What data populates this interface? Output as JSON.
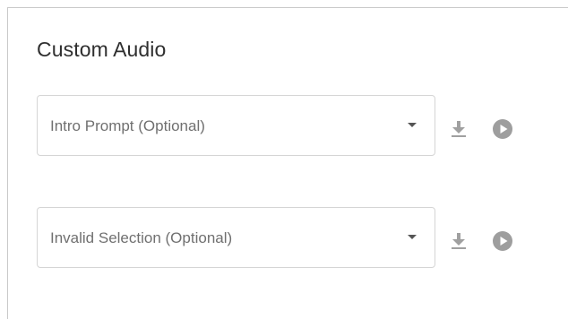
{
  "section": {
    "title": "Custom Audio"
  },
  "rows": [
    {
      "select_label": "Intro Prompt (Optional)"
    },
    {
      "select_label": "Invalid Selection (Optional)"
    }
  ],
  "icons": {
    "download": "download-icon",
    "play": "play-circle-icon",
    "caret": "arrow-drop-down-icon"
  },
  "colors": {
    "icon_gray": "#9e9e9e",
    "title": "#2f2f2f",
    "label": "#707070",
    "border": "#d5d5d5"
  }
}
